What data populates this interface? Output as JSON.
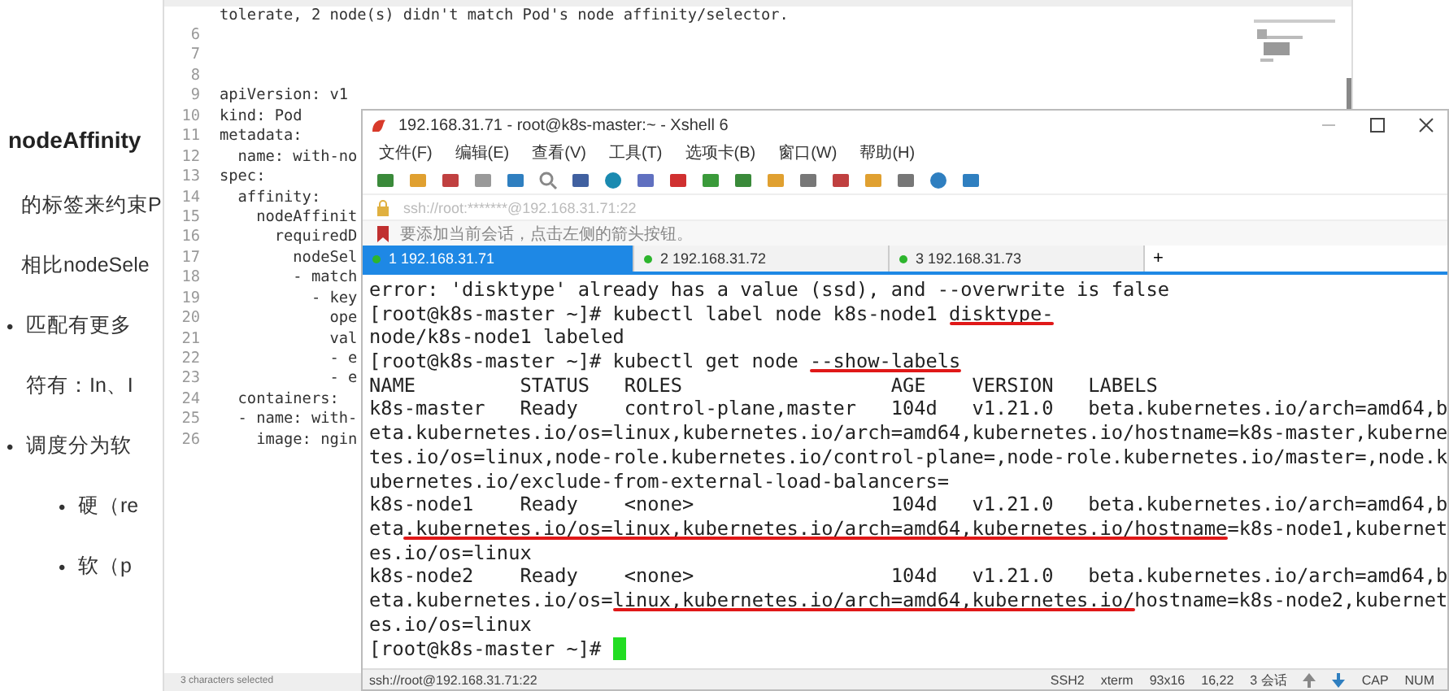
{
  "slide": {
    "heading": "nodeAffinity",
    "lines": [
      {
        "kind": "paragraph",
        "text": "的标签来约束P"
      },
      {
        "kind": "paragraph",
        "text": "相比nodeSele"
      },
      {
        "kind": "bullet",
        "bullet": "•",
        "text": "匹配有更多"
      },
      {
        "kind": "continuation",
        "text": "符有：In、I"
      },
      {
        "kind": "bullet",
        "bullet": "•",
        "text": "调度分为软"
      },
      {
        "kind": "sub_bullet",
        "bullet": "•",
        "text": "硬（re"
      },
      {
        "kind": "sub_bullet",
        "bullet": "•",
        "text": "软（p"
      }
    ]
  },
  "editor": {
    "top_line": "tolerate, 2 node(s) didn't match Pod's node affinity/selector.",
    "lines": [
      {
        "number": "6"
      },
      {
        "number": "7"
      },
      {
        "number": "8"
      },
      {
        "number": "9",
        "code": "apiVersion: v1"
      },
      {
        "number": "10",
        "code": "kind: Pod"
      },
      {
        "number": "11",
        "code": "metadata:"
      },
      {
        "number": "12",
        "code": "  name: with-no"
      },
      {
        "number": "13",
        "code": "spec:"
      },
      {
        "number": "14",
        "code": "  affinity:"
      },
      {
        "number": "15",
        "code": "    nodeAffinit"
      },
      {
        "number": "16",
        "code": "      requiredD"
      },
      {
        "number": "17",
        "code": "        nodeSel"
      },
      {
        "number": "18",
        "code": "        - match"
      },
      {
        "number": "19",
        "code": "          - key"
      },
      {
        "number": "20",
        "code": "            ope"
      },
      {
        "number": "21",
        "code": "            val"
      },
      {
        "number": "22",
        "code": "            - e"
      },
      {
        "number": "23",
        "code": "            - e"
      },
      {
        "number": "24",
        "code": "  containers:"
      },
      {
        "number": "25",
        "code": "  - name: with-"
      },
      {
        "number": "26",
        "code": "    image: ngin"
      }
    ],
    "status": "3 characters selected"
  },
  "xshell": {
    "title": "192.168.31.71 - root@k8s-master:~ - Xshell 6",
    "menu": [
      "文件(F)",
      "编辑(E)",
      "查看(V)",
      "工具(T)",
      "选项卡(B)",
      "窗口(W)",
      "帮助(H)"
    ],
    "address": "ssh://root:*******@192.168.31.71:22",
    "info": "要添加当前会话，点击左侧的箭头按钮。",
    "tabs": [
      {
        "label": "1 192.168.31.71",
        "selected": true
      },
      {
        "label": "2 192.168.31.72",
        "selected": false
      },
      {
        "label": "3 192.168.31.73",
        "selected": false
      }
    ],
    "add_tab": "+",
    "terminal": {
      "lines": [
        {
          "segments": [
            {
              "text": "error: 'disktype' already has a value (ssd), and --overwrite is false",
              "underlined": false
            }
          ]
        },
        {
          "segments": [
            {
              "text": "[root@k8s-master ~]# kubectl label node k8s-node1 ",
              "underlined": false
            },
            {
              "text": "disktype-",
              "underlined": true
            }
          ]
        },
        {
          "segments": [
            {
              "text": "node/k8s-node1 labeled",
              "underlined": false
            }
          ]
        },
        {
          "segments": [
            {
              "text": "[root@k8s-master ~]# kubectl get node ",
              "underlined": false
            },
            {
              "text": "--show-labels",
              "underlined": true
            }
          ]
        },
        {
          "segments": [
            {
              "text": "NAME         STATUS   ROLES                  AGE    VERSION   LABELS",
              "underlined": false
            }
          ]
        },
        {
          "segments": [
            {
              "text": "k8s-master   Ready    control-plane,master   104d   v1.21.0   beta.kubernetes.io/arch=amd64,b",
              "underlined": false
            }
          ]
        },
        {
          "segments": [
            {
              "text": "eta.kubernetes.io/os=linux,kubernetes.io/arch=amd64,kubernetes.io/hostname=k8s-master,kuberne",
              "underlined": false
            }
          ]
        },
        {
          "segments": [
            {
              "text": "tes.io/os=linux,node-role.kubernetes.io/control-plane=,node-role.kubernetes.io/master=,node.k",
              "underlined": false
            }
          ]
        },
        {
          "segments": [
            {
              "text": "ubernetes.io/exclude-from-external-load-balancers=",
              "underlined": false
            }
          ]
        },
        {
          "segments": [
            {
              "text": "k8s-node1    Ready    <none>                 104d   v1.21.0   beta.kubernetes.io/arch=amd64,b",
              "underlined": false
            }
          ]
        },
        {
          "segments": [
            {
              "text": "eta",
              "underlined": false
            },
            {
              "text": ".kubernetes.io/os=linux,kubernetes.io/arch=amd64,kubernetes.io/hostname",
              "underlined": true
            },
            {
              "text": "=k8s-node1,kubernet",
              "underlined": false
            }
          ]
        },
        {
          "segments": [
            {
              "text": "es.io/os=linux",
              "underlined": false
            }
          ]
        },
        {
          "segments": [
            {
              "text": "k8s-node2    Ready    <none>                 104d   v1.21.0   beta.kubernetes.io/arch=amd64,b",
              "underlined": false
            }
          ]
        },
        {
          "segments": [
            {
              "text": "eta.kubernetes.io/os=",
              "underlined": false
            },
            {
              "text": "linux,kubernetes.io/arch=amd64,kubernetes.io/",
              "underlined": true
            },
            {
              "text": "hostname=k8s-node2,kubernet",
              "underlined": false
            }
          ]
        },
        {
          "segments": [
            {
              "text": "es.io/os=linux",
              "underlined": false
            }
          ]
        }
      ],
      "prompt": "[root@k8s-master ~]# "
    },
    "status": {
      "session": "ssh://root@192.168.31.71:22",
      "items": [
        "SSH2",
        "xterm",
        "93x16",
        "16,22",
        "3 会话"
      ],
      "keys": [
        "CAP",
        "NUM"
      ]
    }
  }
}
